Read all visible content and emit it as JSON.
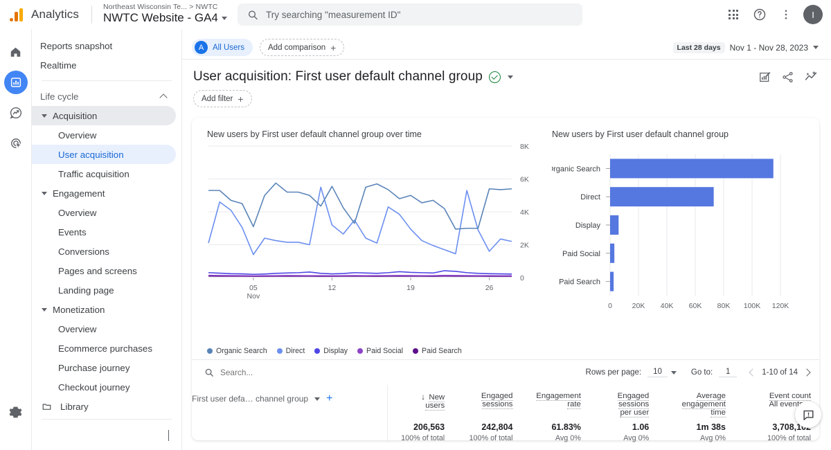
{
  "header": {
    "brand": "Analytics",
    "breadcrumb_account": "Northeast Wisconsin Te...",
    "breadcrumb_sep": ">",
    "breadcrumb_property": "NWTC",
    "property_name": "NWTC Website - GA4",
    "search_placeholder": "Try searching \"measurement ID\"",
    "search_value": "",
    "avatar_initial": "I",
    "icons": [
      "apps-grid-icon",
      "help-icon",
      "more-vert-icon",
      "avatar"
    ]
  },
  "rail": {
    "items": [
      {
        "name": "home-icon",
        "label": "Home",
        "active": false
      },
      {
        "name": "reports-icon",
        "label": "Reports",
        "active": true
      },
      {
        "name": "explore-icon",
        "label": "Explore",
        "active": false
      },
      {
        "name": "advertising-icon",
        "label": "Advertising",
        "active": false
      }
    ],
    "settings_label": "Admin"
  },
  "nav": {
    "top": [
      {
        "label": "Reports snapshot",
        "level": 1,
        "state": "normal"
      },
      {
        "label": "Realtime",
        "level": 1,
        "state": "normal"
      }
    ],
    "group_label": "Life cycle",
    "items": [
      {
        "label": "Acquisition",
        "level": 2,
        "state": "soft",
        "expander": true
      },
      {
        "label": "Overview",
        "level": 3,
        "state": "normal"
      },
      {
        "label": "User acquisition",
        "level": 3,
        "state": "selected"
      },
      {
        "label": "Traffic acquisition",
        "level": 3,
        "state": "normal"
      },
      {
        "label": "Engagement",
        "level": 2,
        "state": "normal",
        "expander": true
      },
      {
        "label": "Overview",
        "level": 3,
        "state": "normal"
      },
      {
        "label": "Events",
        "level": 3,
        "state": "normal"
      },
      {
        "label": "Conversions",
        "level": 3,
        "state": "normal"
      },
      {
        "label": "Pages and screens",
        "level": 3,
        "state": "normal"
      },
      {
        "label": "Landing page",
        "level": 3,
        "state": "normal"
      },
      {
        "label": "Monetization",
        "level": 2,
        "state": "normal",
        "expander": true
      },
      {
        "label": "Overview",
        "level": 3,
        "state": "normal"
      },
      {
        "label": "Ecommerce purchases",
        "level": 3,
        "state": "normal"
      },
      {
        "label": "Purchase journey",
        "level": 3,
        "state": "normal"
      },
      {
        "label": "Checkout journey",
        "level": 3,
        "state": "normal"
      }
    ],
    "library_label": "Library",
    "collapse_label": "Collapse menu"
  },
  "toolbar": {
    "segment_initial": "A",
    "segment_label": "All Users",
    "add_comparison_label": "Add comparison",
    "date_tag": "Last 28 days",
    "date_range": "Nov 1 - Nov 28, 2023",
    "page_title": "User acquisition: First user default channel group",
    "add_filter_label": "Add filter",
    "actions": [
      "edit-chart-icon",
      "share-icon",
      "insights-icon"
    ]
  },
  "chart_data": [
    {
      "type": "line",
      "title": "New users by First user default channel group over time",
      "xlabel": "",
      "ylabel": "",
      "ylim": [
        0,
        8000
      ],
      "yticks": [
        0,
        2000,
        4000,
        6000,
        8000
      ],
      "ytick_labels": [
        "0",
        "2K",
        "4K",
        "6K",
        "8K"
      ],
      "x": [
        1,
        2,
        3,
        4,
        5,
        6,
        7,
        8,
        9,
        10,
        11,
        12,
        13,
        14,
        15,
        16,
        17,
        18,
        19,
        20,
        21,
        22,
        23,
        24,
        25,
        26,
        27,
        28
      ],
      "xtick_positions": [
        5,
        12,
        19,
        26
      ],
      "xtick_labels": [
        "05",
        "12",
        "19",
        "26"
      ],
      "xtick_sublabel": "Nov",
      "grid": true,
      "legend_position": "bottom",
      "series": [
        {
          "name": "Organic Search",
          "color": "#5a84b8",
          "values": [
            5300,
            5300,
            4700,
            4500,
            3100,
            5000,
            5750,
            5200,
            5200,
            5000,
            4350,
            5550,
            4250,
            3300,
            5500,
            5700,
            5350,
            4800,
            5000,
            4550,
            4700,
            4200,
            2950,
            3000,
            3000,
            5400,
            5350,
            5400
          ]
        },
        {
          "name": "Direct",
          "color": "#6c8ff0",
          "values": [
            2100,
            4600,
            4100,
            3050,
            1400,
            2400,
            2250,
            2150,
            2150,
            2000,
            5500,
            3200,
            2650,
            3500,
            2400,
            2100,
            4300,
            3850,
            2950,
            2250,
            1950,
            1700,
            1450,
            5300,
            2900,
            1600,
            2350,
            2200
          ]
        },
        {
          "name": "Display",
          "color": "#4f46e5",
          "values": [
            300,
            270,
            240,
            230,
            200,
            220,
            260,
            280,
            300,
            340,
            260,
            230,
            250,
            300,
            280,
            260,
            300,
            360,
            320,
            300,
            280,
            420,
            380,
            300,
            260,
            240,
            230,
            220
          ]
        },
        {
          "name": "Paid Social",
          "color": "#8b44c8",
          "values": [
            140,
            130,
            125,
            120,
            110,
            115,
            120,
            130,
            125,
            120,
            118,
            115,
            120,
            125,
            120,
            118,
            122,
            130,
            125,
            120,
            118,
            135,
            130,
            125,
            120,
            118,
            115,
            112
          ]
        },
        {
          "name": "Paid Search",
          "color": "#5b0f8a",
          "values": [
            90,
            88,
            85,
            84,
            82,
            83,
            85,
            88,
            86,
            84,
            83,
            82,
            84,
            86,
            84,
            83,
            85,
            88,
            86,
            84,
            83,
            90,
            88,
            86,
            84,
            83,
            82,
            80
          ]
        }
      ]
    },
    {
      "type": "bar",
      "orientation": "horizontal",
      "title": "New users by First user default channel group",
      "categories": [
        "Organic Search",
        "Direct",
        "Display",
        "Paid Social",
        "Paid Search"
      ],
      "values": [
        115000,
        73000,
        6000,
        3000,
        2500
      ],
      "bar_color": "#5577e0",
      "xlim": [
        0,
        120000
      ],
      "xticks": [
        0,
        20000,
        40000,
        60000,
        80000,
        100000,
        120000
      ],
      "xtick_labels": [
        "0",
        "20K",
        "40K",
        "60K",
        "80K",
        "100K",
        "120K"
      ],
      "grid": true
    }
  ],
  "table": {
    "search_placeholder": "Search...",
    "rows_per_page_label": "Rows per page:",
    "rows_per_page_value": "10",
    "goto_label": "Go to:",
    "goto_value": "1",
    "range_label": "1-10 of 14",
    "dimension_label": "First user defa… channel group",
    "columns": [
      {
        "line1": "New",
        "line2": "users",
        "sorted": true
      },
      {
        "line1": "Engaged",
        "line2": "sessions"
      },
      {
        "line1": "Engagement",
        "line2": "rate"
      },
      {
        "line1": "Engaged",
        "line2": "sessions",
        "line3": "per user"
      },
      {
        "line1": "Average",
        "line2": "engagement",
        "line3": "time"
      },
      {
        "line1": "Event count",
        "selector": "All events"
      }
    ],
    "totals": [
      {
        "value": "206,563",
        "sub": "100% of total"
      },
      {
        "value": "242,804",
        "sub": "100% of total"
      },
      {
        "value": "61.83%",
        "sub": "Avg 0%"
      },
      {
        "value": "1.06",
        "sub": "Avg 0%"
      },
      {
        "value": "1m 38s",
        "sub": "Avg 0%"
      },
      {
        "value": "3,708,102",
        "sub": "100% of total"
      }
    ]
  },
  "fab": {
    "name": "feedback-icon",
    "label": "Send feedback"
  }
}
